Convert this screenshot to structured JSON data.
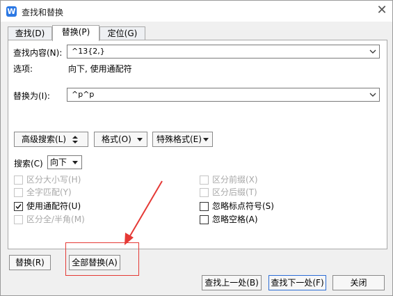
{
  "window": {
    "title": "查找和替换"
  },
  "tabs": [
    {
      "label": "查找(D)"
    },
    {
      "label": "替换(P)"
    },
    {
      "label": "定位(G)"
    }
  ],
  "find": {
    "label": "查找内容(N):",
    "value": "^13{2,}"
  },
  "options": {
    "label": "选项:",
    "value": "向下, 使用通配符"
  },
  "replace": {
    "label": "替换为(I):",
    "value": "^p^p"
  },
  "buttons": {
    "advanced": "高级搜索(L)",
    "format": "格式(O)",
    "special": "特殊格式(E)",
    "replace": "替换(R)",
    "replace_all": "全部替换(A)",
    "find_prev": "查找上一处(B)",
    "find_next": "查找下一处(F)",
    "close": "关闭"
  },
  "search": {
    "label": "搜索(C)",
    "value": "向下"
  },
  "checkboxes": {
    "match_case": {
      "label": "区分大小写(H)",
      "checked": false,
      "disabled": true
    },
    "whole_word": {
      "label": "全字匹配(Y)",
      "checked": false,
      "disabled": true
    },
    "wildcards": {
      "label": "使用通配符(U)",
      "checked": true,
      "disabled": false
    },
    "full_half": {
      "label": "区分全/半角(M)",
      "checked": false,
      "disabled": true
    },
    "prefix": {
      "label": "区分前缀(X)",
      "checked": false,
      "disabled": true
    },
    "suffix": {
      "label": "区分后缀(T)",
      "checked": false,
      "disabled": true
    },
    "ignore_punct": {
      "label": "忽略标点符号(S)",
      "checked": false,
      "disabled": false
    },
    "ignore_space": {
      "label": "忽略空格(A)",
      "checked": false,
      "disabled": false
    }
  },
  "annotation_color": "#e53935"
}
